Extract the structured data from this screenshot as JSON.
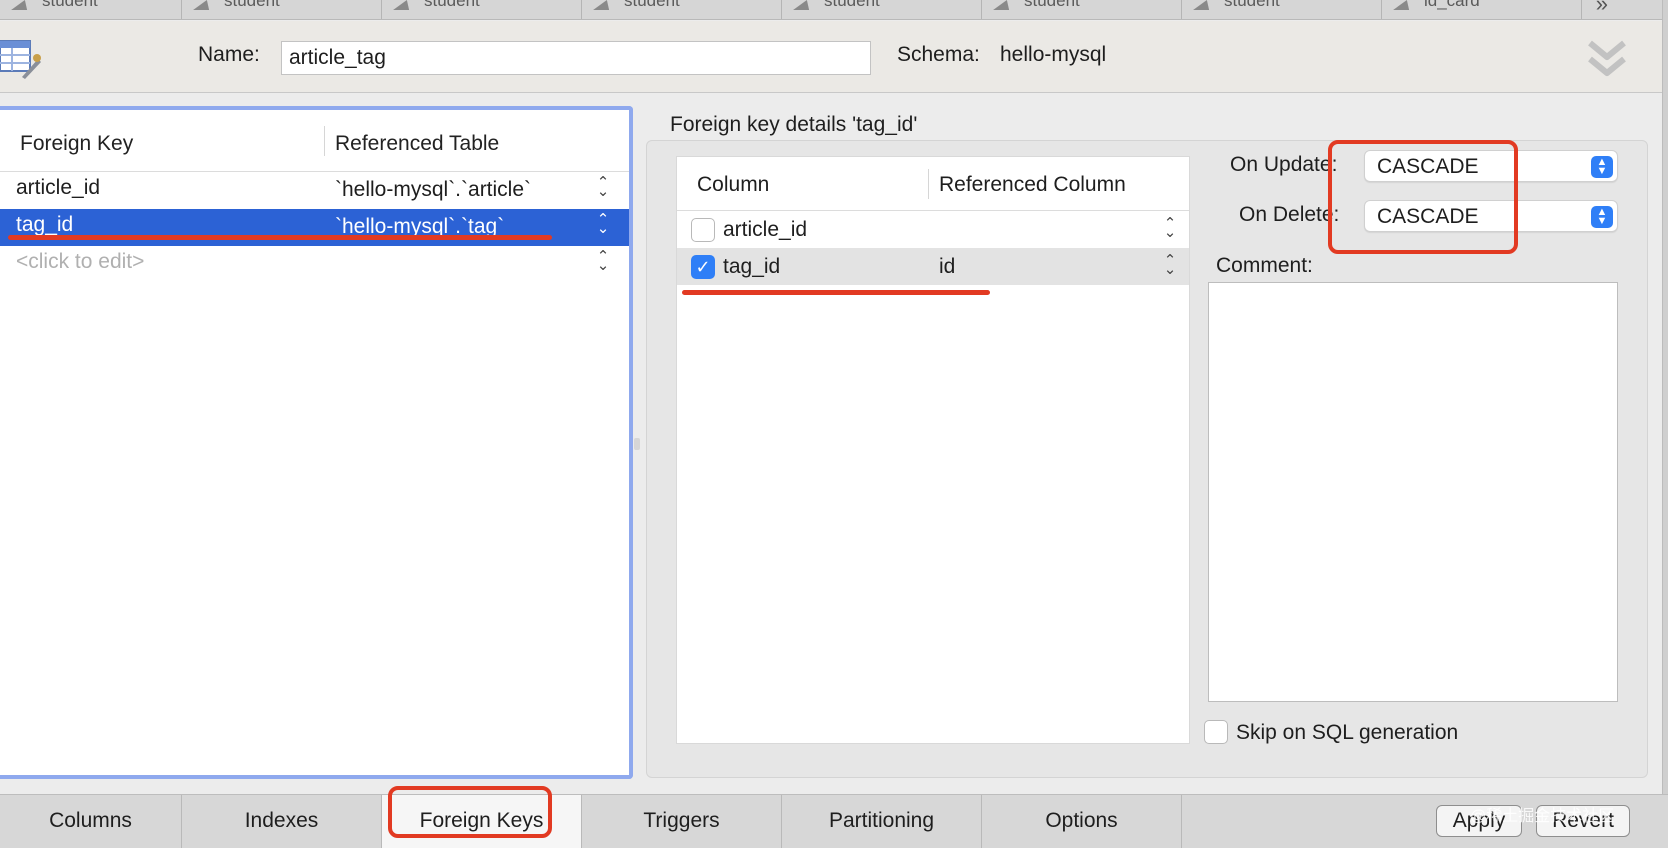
{
  "top_tabs": [
    "student",
    "student",
    "student",
    "student",
    "student",
    "student",
    "student",
    "id_card"
  ],
  "top_tabs_more": "»",
  "header": {
    "name_label": "Name:",
    "name_value": "article_tag",
    "schema_label": "Schema:",
    "schema_value": "hello-mysql"
  },
  "foreign_keys": {
    "headers": {
      "foreign_key": "Foreign Key",
      "referenced_table": "Referenced Table"
    },
    "rows": [
      {
        "name": "article_id",
        "table": "`hello-mysql`.`article`"
      },
      {
        "name": "tag_id",
        "table": "`hello-mysql`.`tag`"
      }
    ],
    "placeholder": "<click to edit>",
    "selected_index": 1
  },
  "details": {
    "title": "Foreign key details 'tag_id'",
    "headers": {
      "column": "Column",
      "referenced_column": "Referenced Column"
    },
    "columns": [
      {
        "name": "article_id",
        "checked": false,
        "ref": ""
      },
      {
        "name": "tag_id",
        "checked": true,
        "ref": "id"
      }
    ],
    "on_update_label": "On Update:",
    "on_update_value": "CASCADE",
    "on_delete_label": "On Delete:",
    "on_delete_value": "CASCADE",
    "comment_label": "Comment:",
    "comment_value": "",
    "skip_label": "Skip on SQL generation",
    "skip_checked": false
  },
  "bottom_tabs": [
    "Columns",
    "Indexes",
    "Foreign Keys",
    "Triggers",
    "Partitioning",
    "Options"
  ],
  "active_bottom_tab": "Foreign Keys",
  "buttons": {
    "apply": "Apply",
    "revert": "Revert"
  },
  "watermark": "@稀土掘金技术社区",
  "colors": {
    "selection": "#2c62d5",
    "focus_ring": "#8fa9ee",
    "annotation": "#e23a22",
    "accent": "#2f7ff7"
  }
}
